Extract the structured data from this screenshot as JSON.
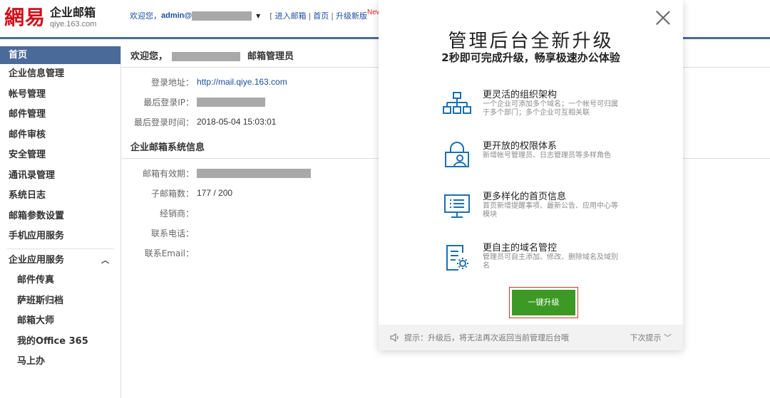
{
  "header": {
    "logo_mark": "網易",
    "logo_title": "企业邮箱",
    "logo_sub": "qiye.163.com",
    "welcome_prefix": "欢迎您，",
    "welcome_user": "admin@",
    "links": [
      "进入邮箱",
      "首页",
      "升级新版"
    ],
    "new_badge": "New"
  },
  "sidebar": {
    "items": [
      "首页",
      "企业信息管理",
      "帐号管理",
      "邮件管理",
      "邮件审核",
      "安全管理",
      "通讯录管理",
      "系统日志",
      "邮箱参数设置",
      "手机应用服务"
    ],
    "group_label": "企业应用服务",
    "sub_items": [
      "邮件传真",
      "萨班斯归档",
      "邮箱大师",
      "我的Office 365",
      "马上办"
    ]
  },
  "main": {
    "welcome_prefix": "欢迎您，",
    "welcome_role": "邮箱管理员",
    "login_rows": [
      {
        "label": "登录地址：",
        "value": "http://mail.qiye.163.com"
      },
      {
        "label": "最后登录IP：",
        "value": ""
      },
      {
        "label": "最后登录时间：",
        "value": "2018-05-04 15:03:01"
      }
    ],
    "sys_title": "企业邮箱系统信息",
    "sys_rows": [
      {
        "label": "邮箱有效期：",
        "value": ""
      },
      {
        "label": "子邮箱数：",
        "value": "177 / 200"
      },
      {
        "label": "经销商：",
        "value": ""
      },
      {
        "label": "联系电话：",
        "value": ""
      },
      {
        "label": "联系Email：",
        "value": ""
      }
    ]
  },
  "modal": {
    "title": "管理后台全新升级",
    "subtitle": "2秒即可完成升级，畅享极速办公体验",
    "features": [
      {
        "icon": "org-chart-icon",
        "title": "更灵活的组织架构",
        "desc": "一个企业可添加多个域名；一个帐号可归属于多个部门；多个企业可互相关联"
      },
      {
        "icon": "lock-user-icon",
        "title": "更开放的权限体系",
        "desc": "新增帐号管理员、日志管理员等多样角色"
      },
      {
        "icon": "monitor-list-icon",
        "title": "更多样化的首页信息",
        "desc": "首页新增提醒事项、最新公告、应用中心等模块"
      },
      {
        "icon": "domain-settings-icon",
        "title": "更自主的域名管控",
        "desc": "管理员可自主添加、修改、删除域名及域别名"
      }
    ],
    "upgrade_label": "一键升级",
    "footer_tip": "提示：升级后，将无法再次返回当前管理后台哦",
    "footer_next": "下次提示"
  },
  "colors": {
    "nav_active": "#4a6a9a",
    "link": "#1a4fa0",
    "upgrade_button": "#3c9a24",
    "feature_icon": "#1a6fb5",
    "logo_red": "#d0101a"
  }
}
